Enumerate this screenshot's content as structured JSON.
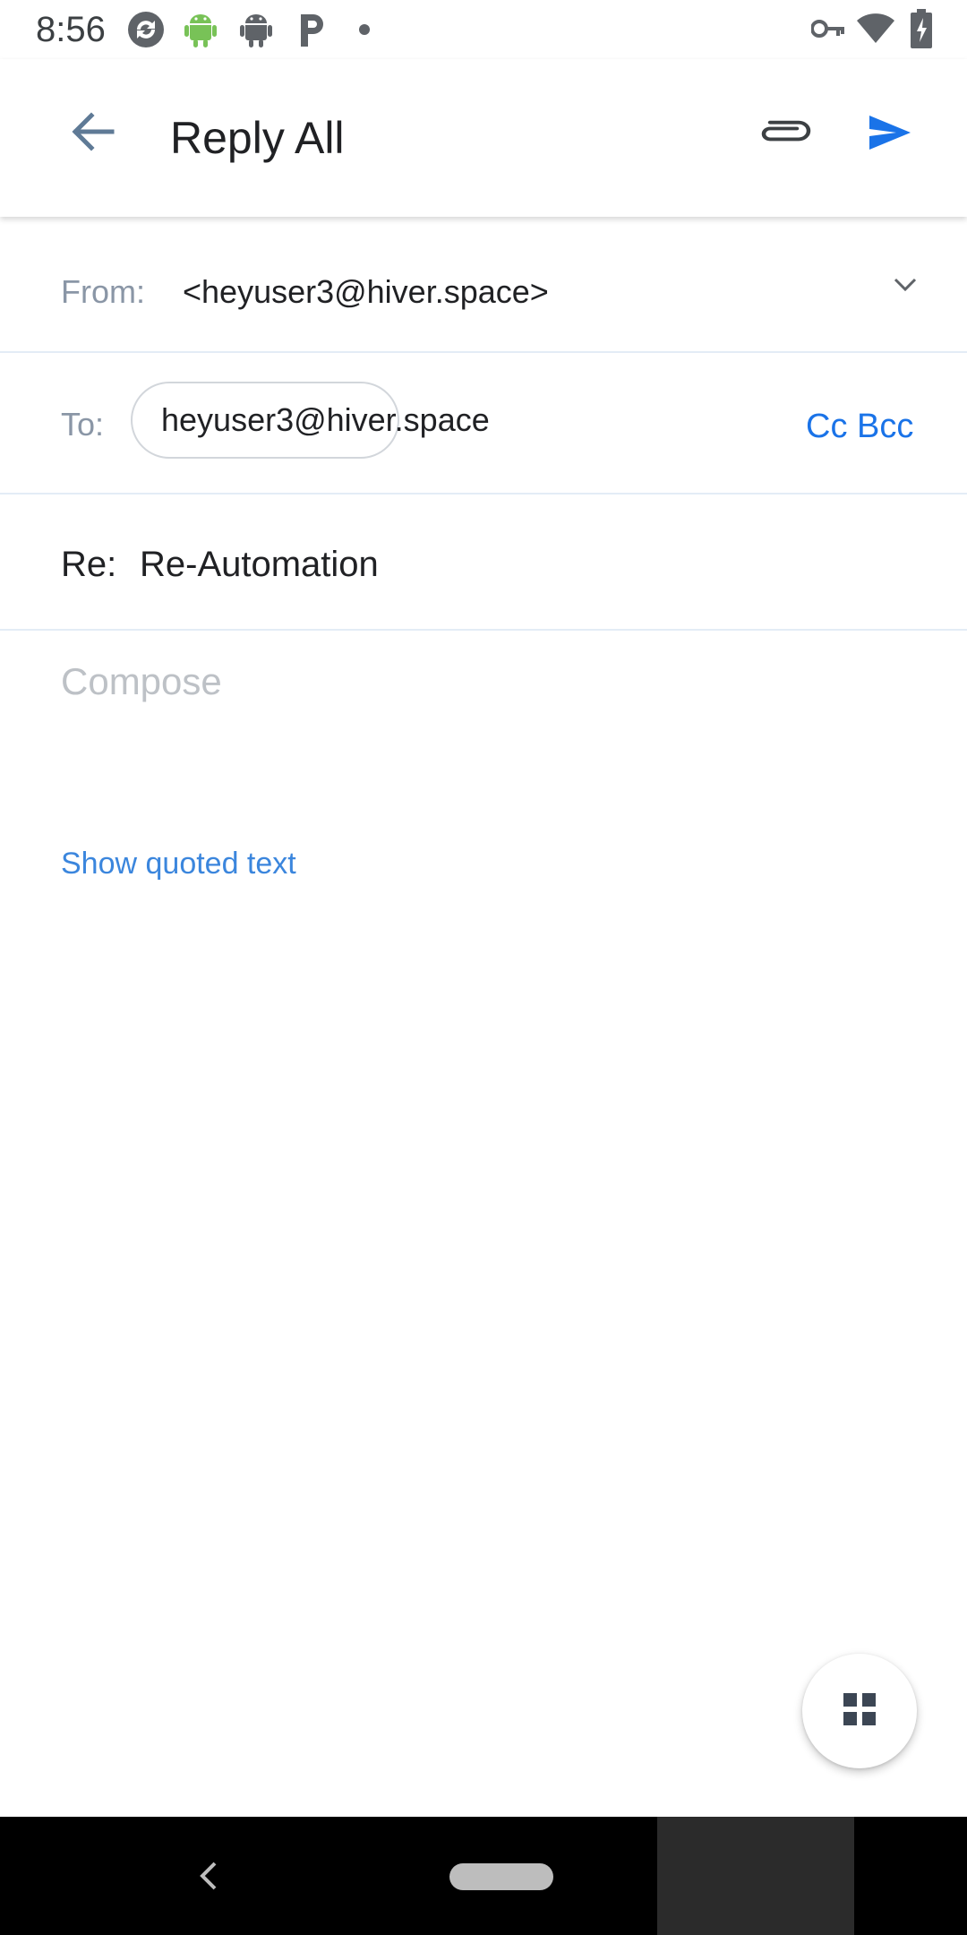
{
  "status_bar": {
    "time": "8:56",
    "notification_icons": [
      "sync-icon",
      "android-icon",
      "android-icon",
      "parking-app-icon",
      "dot-icon"
    ],
    "system_icons": [
      "vpn-key-icon",
      "wifi-icon",
      "battery-charging-icon"
    ]
  },
  "app_bar": {
    "title": "Reply All",
    "back_icon": "arrow-left-icon",
    "attach_icon": "paperclip-icon",
    "send_icon": "send-icon",
    "accent_color": "#1a73e8"
  },
  "from": {
    "label": "From:",
    "value": "<heyuser3@hiver.space>"
  },
  "to": {
    "label": "To:",
    "recipient": "heyuser3@hiver.space",
    "cc_bcc": "Cc Bcc"
  },
  "subject": {
    "label": "Re:",
    "value": "Re-Automation"
  },
  "body": {
    "placeholder": "Compose",
    "show_quoted": "Show quoted text"
  },
  "fab": {
    "icon": "grid-icon"
  }
}
